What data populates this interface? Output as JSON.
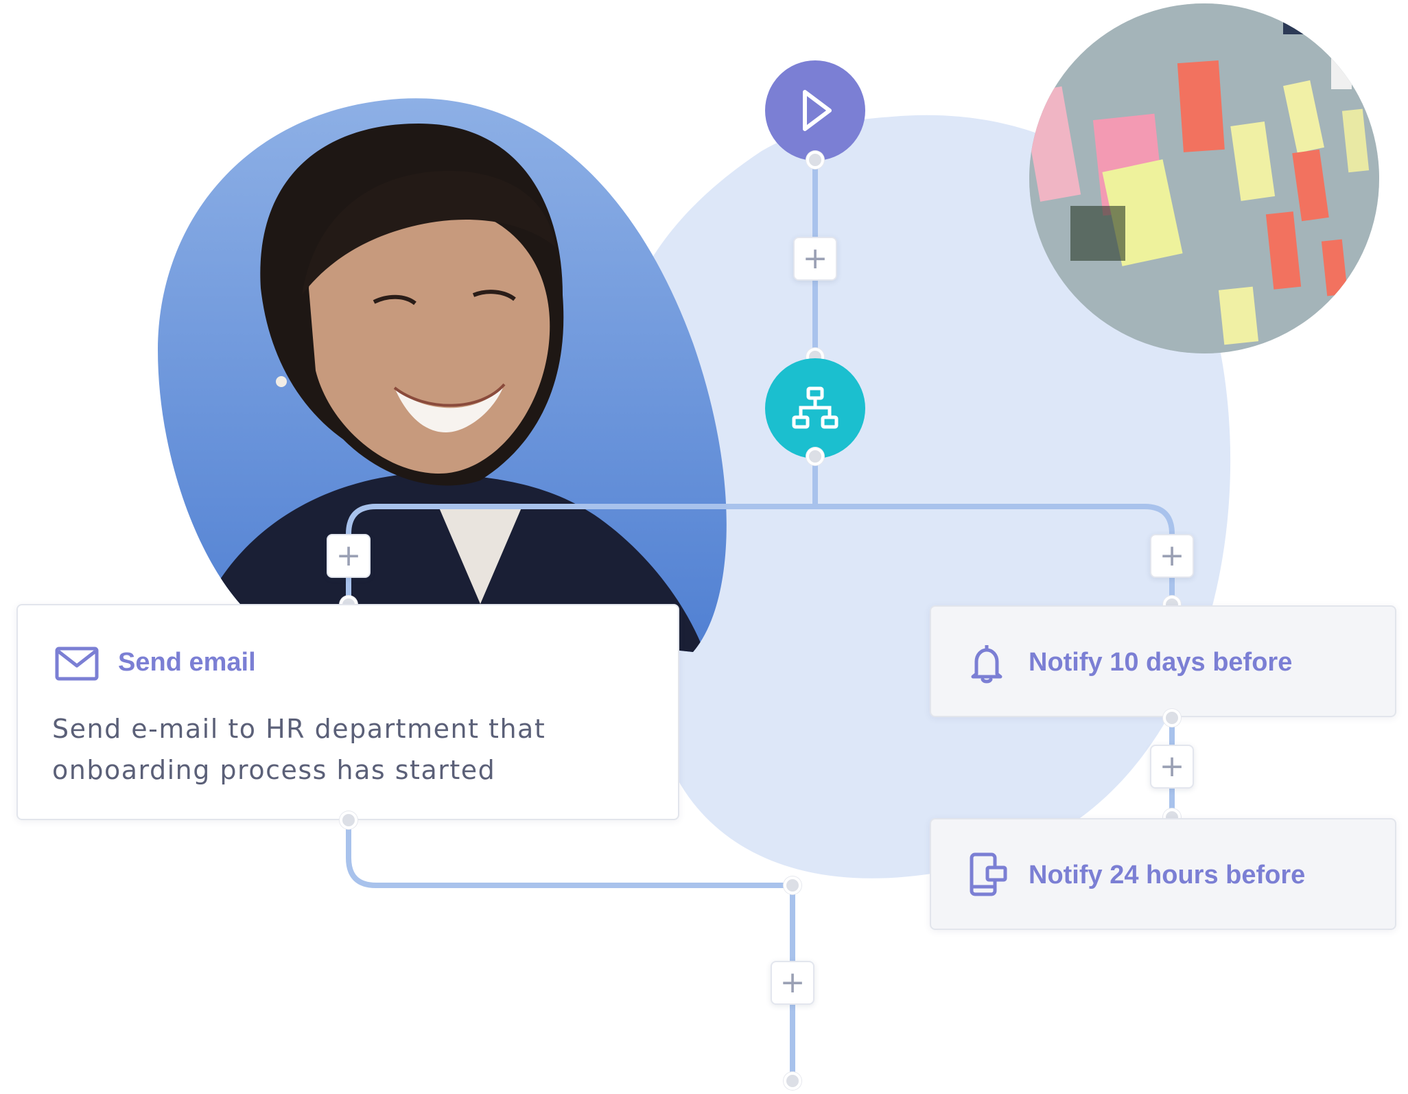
{
  "colors": {
    "accent": "#7b7fd4",
    "start_node": "#7b7fd4",
    "branch_node": "#1bbfcf",
    "connector": "#a8c2ec",
    "blob": "#dde7f8"
  },
  "flow": {
    "start_node_icon": "play-icon",
    "branch_node_icon": "hierarchy-icon",
    "add_step_label": "+"
  },
  "cards": {
    "send_email": {
      "icon": "envelope-icon",
      "title": "Send email",
      "description_line1": "Send e-mail to HR department that",
      "description_line2": "onboarding process has started"
    },
    "notify_days": {
      "icon": "bell-icon",
      "title": "Notify 10 days before"
    },
    "notify_hours": {
      "icon": "mobile-message-icon",
      "title": "Notify 24 hours before"
    }
  }
}
